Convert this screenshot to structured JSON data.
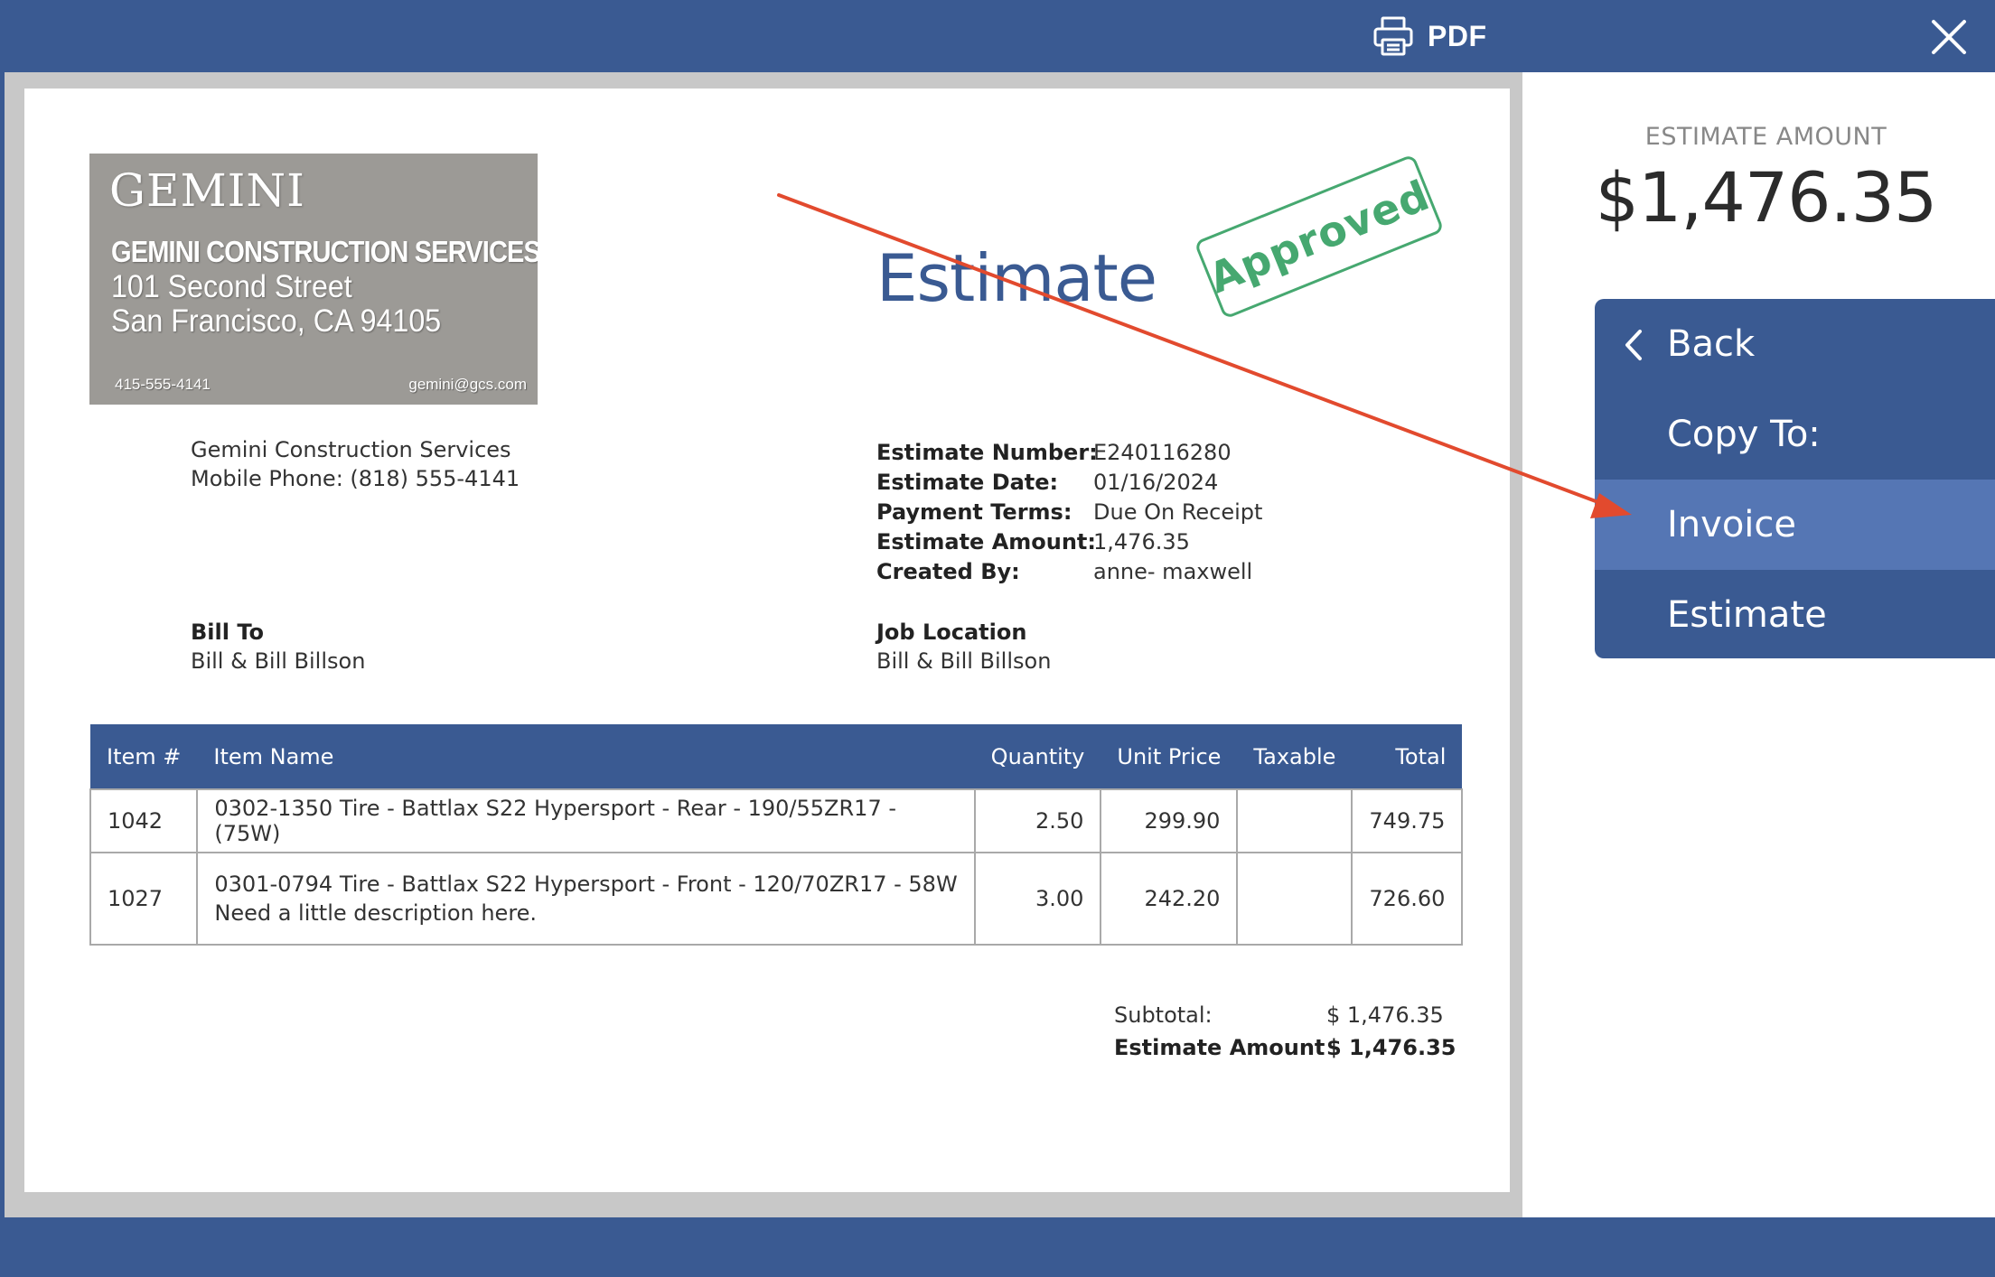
{
  "toolbar": {
    "pdf_label": "PDF",
    "icons": {
      "print": "printer-icon",
      "close": "close-icon"
    }
  },
  "document": {
    "logo": {
      "title": "GEMINI",
      "company": "GEMINI CONSTRUCTION SERVICES",
      "address_line1": "101 Second Street",
      "address_line2": "San Francisco, CA  94105",
      "phone": "415-555-4141",
      "email": "gemini@gcs.com"
    },
    "company_name": "Gemini Construction Services",
    "company_phone": "Mobile Phone: (818) 555-4141",
    "title": "Estimate",
    "stamp": "Approved",
    "meta": [
      {
        "label": "Estimate Number:",
        "value": "E240116280"
      },
      {
        "label": "Estimate Date:",
        "value": "01/16/2024"
      },
      {
        "label": "Payment Terms:",
        "value": "Due On Receipt"
      },
      {
        "label": "Estimate Amount:",
        "value": "1,476.35"
      },
      {
        "label": "Created By:",
        "value": "anne- maxwell"
      }
    ],
    "bill_to": {
      "title": "Bill To",
      "value": "Bill & Bill Billson"
    },
    "job_location": {
      "title": "Job Location",
      "value": "Bill & Bill Billson"
    },
    "table": {
      "headers": [
        "Item #",
        "Item Name",
        "Quantity",
        "Unit Price",
        "Taxable",
        "Total"
      ],
      "rows": [
        {
          "item": "1042",
          "name": "0302-1350 Tire - Battlax S22 Hypersport - Rear - 190/55ZR17 - (75W)",
          "description": "",
          "quantity": "2.50",
          "unit_price": "299.90",
          "taxable": "",
          "total": "749.75"
        },
        {
          "item": "1027",
          "name": "0301-0794 Tire - Battlax S22 Hypersport - Front - 120/70ZR17 - 58W",
          "description": "Need a little description here.",
          "quantity": "3.00",
          "unit_price": "242.20",
          "taxable": "",
          "total": "726.60"
        }
      ]
    },
    "totals": {
      "subtotal_label": "Subtotal:",
      "subtotal_value": "$ 1,476.35",
      "amount_label": "Estimate Amount",
      "amount_value": "$ 1,476.35"
    }
  },
  "side_panel": {
    "amount_label": "ESTIMATE AMOUNT",
    "amount_value": "$1,476.35",
    "menu": {
      "back": "Back",
      "copy_to": "Copy To:",
      "invoice": "Invoice",
      "estimate": "Estimate"
    }
  },
  "colors": {
    "brand": "#3a5a92",
    "menu_selected": "#5576b4",
    "stamp": "#46a870",
    "annotation_arrow": "#e24a2e"
  }
}
